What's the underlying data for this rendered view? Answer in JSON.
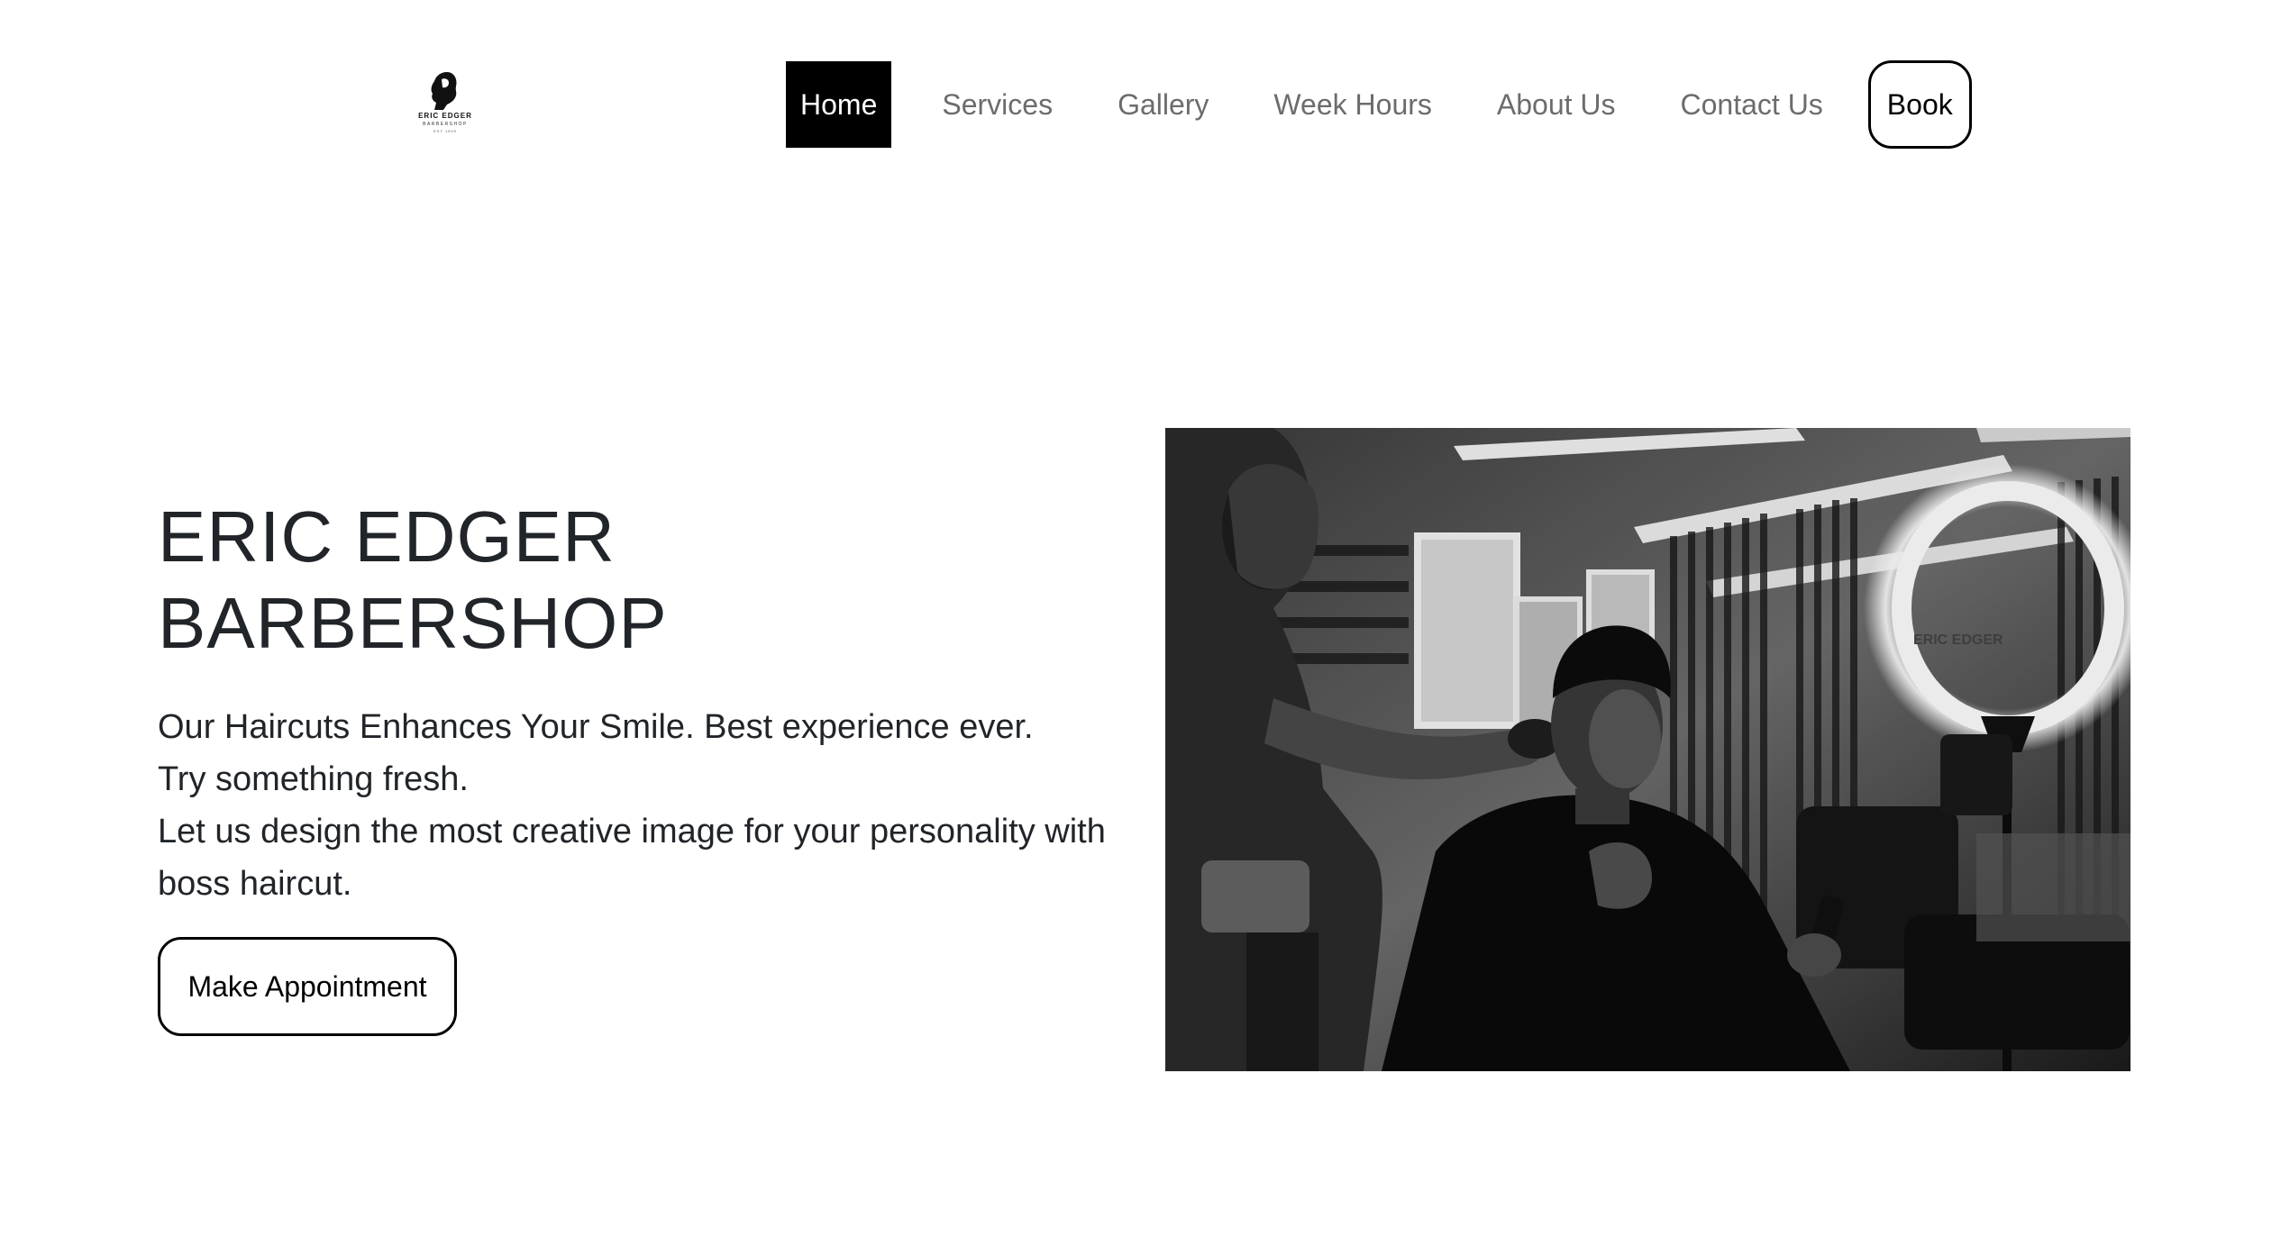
{
  "brand": {
    "logo_icon": "barber-silhouette-icon",
    "logo_name": "ERIC EDGER",
    "logo_sub": "BARBERSHOP",
    "logo_est": "EST 1990"
  },
  "nav": {
    "items": [
      {
        "label": "Home",
        "active": true
      },
      {
        "label": "Services",
        "active": false
      },
      {
        "label": "Gallery",
        "active": false
      },
      {
        "label": "Week Hours",
        "active": false
      },
      {
        "label": "About Us",
        "active": false
      },
      {
        "label": "Contact Us",
        "active": false
      }
    ],
    "book_label": "Book"
  },
  "hero": {
    "title_line1": "ERIC EDGER",
    "title_line2": "BARBERSHOP",
    "lines": [
      "Our Haircuts Enhances Your Smile. Best experience ever.",
      "Try something fresh.",
      "Let us design the most creative image for your personality with",
      "boss haircut."
    ],
    "cta_label": "Make Appointment",
    "image_icon": "barbershop-photo",
    "photo_sign": "ERIC EDGER"
  },
  "colors": {
    "active_nav_bg": "#000000",
    "nav_text": "#6c6c6c",
    "heading": "#212529",
    "border": "#000000"
  }
}
